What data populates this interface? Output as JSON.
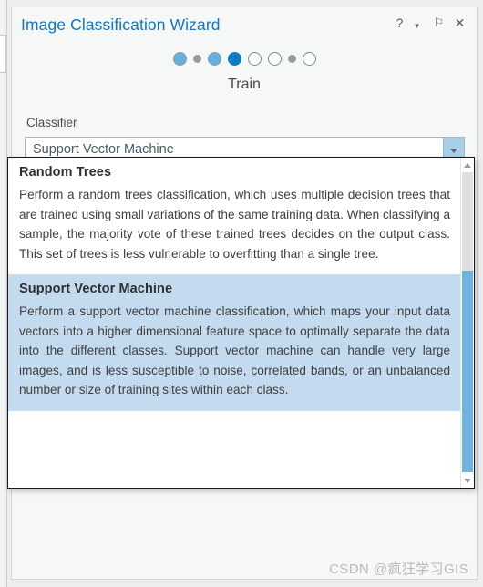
{
  "window": {
    "title": "Image Classification Wizard",
    "accent_color": "#1673b8",
    "title_color": "#1176c8",
    "controls": {
      "help": "?",
      "menu": "▾",
      "pin": "⚐",
      "close": "✕"
    }
  },
  "steps": {
    "label": "Train",
    "dots": [
      {
        "state": "done",
        "size": "lg"
      },
      {
        "state": "minor",
        "size": "sm"
      },
      {
        "state": "done",
        "size": "lg"
      },
      {
        "state": "current",
        "size": "lg"
      },
      {
        "state": "todo",
        "size": "lg"
      },
      {
        "state": "todo",
        "size": "lg"
      },
      {
        "state": "minor",
        "size": "sm"
      },
      {
        "state": "todo",
        "size": "lg"
      }
    ],
    "colors": {
      "done": "#64b0e0",
      "current": "#0d7cc4",
      "todo": "#ffffff",
      "minor": "#9a9a9a"
    }
  },
  "classifier": {
    "label": "Classifier",
    "value": "Support Vector Machine",
    "placeholder": "Select a classifier",
    "arrow_icon": "chevron-down-icon"
  },
  "dropdown": {
    "expanded": true,
    "highlight_color": "#c4dbef",
    "options": [
      {
        "title": "Random Trees",
        "description": "Perform a random trees classification, which uses multiple decision trees that are trained using small variations of the same training data. When classifying a sample, the majority vote of these trained trees decides on the output class. This set of trees is less vulnerable to overfitting than a single tree.",
        "selected": false
      },
      {
        "title": "Support Vector Machine",
        "description": "Perform a support vector machine classification, which maps your input data vectors into a higher dimensional feature space to optimally separate the data into the different classes. Support vector machine can handle very large images, and is less susceptible to noise, correlated bands, or an unbalanced number or size of training sites within each class.",
        "selected": true
      }
    ],
    "scrollbar": {
      "up_arrow": "triangle-up-icon",
      "down_arrow": "triangle-down-icon",
      "thumb_color": "#6fb3e0",
      "track_color": "#e0e0e0"
    }
  },
  "watermark": {
    "text": "CSDN @疯狂学习GIS"
  }
}
